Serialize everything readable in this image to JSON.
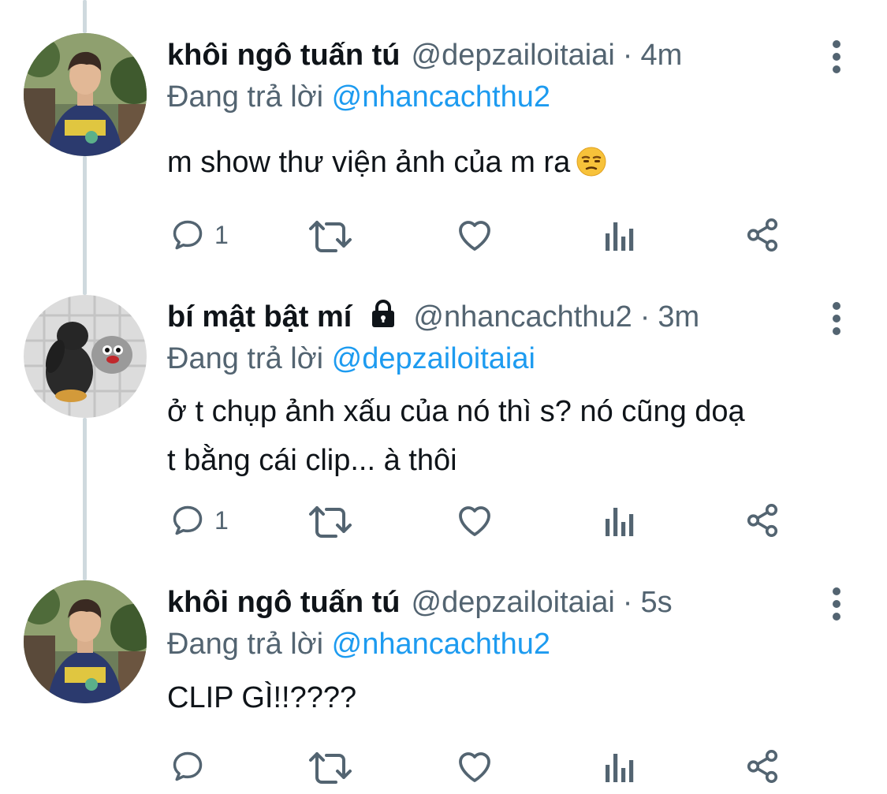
{
  "tweets": [
    {
      "name": "khôi ngô tuấn tú",
      "handle": "@depzailoitaiai",
      "separator": "·",
      "time": "4m",
      "reply_prefix": "Đang trả lời",
      "reply_to": "@nhancachthu2",
      "text_lines": [
        "m show thư viện ảnh của m ra"
      ],
      "emoji": "unamused-face-emoji",
      "locked": false,
      "reply_count": "1",
      "avatar": "person-photo-avatar"
    },
    {
      "name": "bí mật bật mí",
      "handle": "@nhancachthu2",
      "separator": "·",
      "time": "3m",
      "reply_prefix": "Đang trả lời",
      "reply_to": "@depzailoitaiai",
      "text_lines": [
        "ở t chụp ảnh xấu của nó thì s? nó cũng doạ",
        "t bằng cái clip... à thôi"
      ],
      "locked": true,
      "reply_count": "1",
      "avatar": "plush-toy-photo-avatar"
    },
    {
      "name": "khôi ngô tuấn tú",
      "handle": "@depzailoitaiai",
      "separator": "·",
      "time": "5s",
      "reply_prefix": "Đang trả lời",
      "reply_to": "@nhancachthu2",
      "text_lines": [
        "CLIP GÌ!!????"
      ],
      "locked": false,
      "reply_count": "",
      "avatar": "person-photo-avatar"
    }
  ],
  "icons": {
    "reply": "speech-bubble-icon",
    "retweet": "retweet-icon",
    "like": "heart-icon",
    "views": "bar-chart-icon",
    "share": "share-icon",
    "more": "vertical-dots-icon",
    "lock": "lock-icon"
  },
  "colors": {
    "text": "#0f1419",
    "secondary": "#536471",
    "link": "#1d9bf0",
    "thread_line": "#cfd9de"
  }
}
